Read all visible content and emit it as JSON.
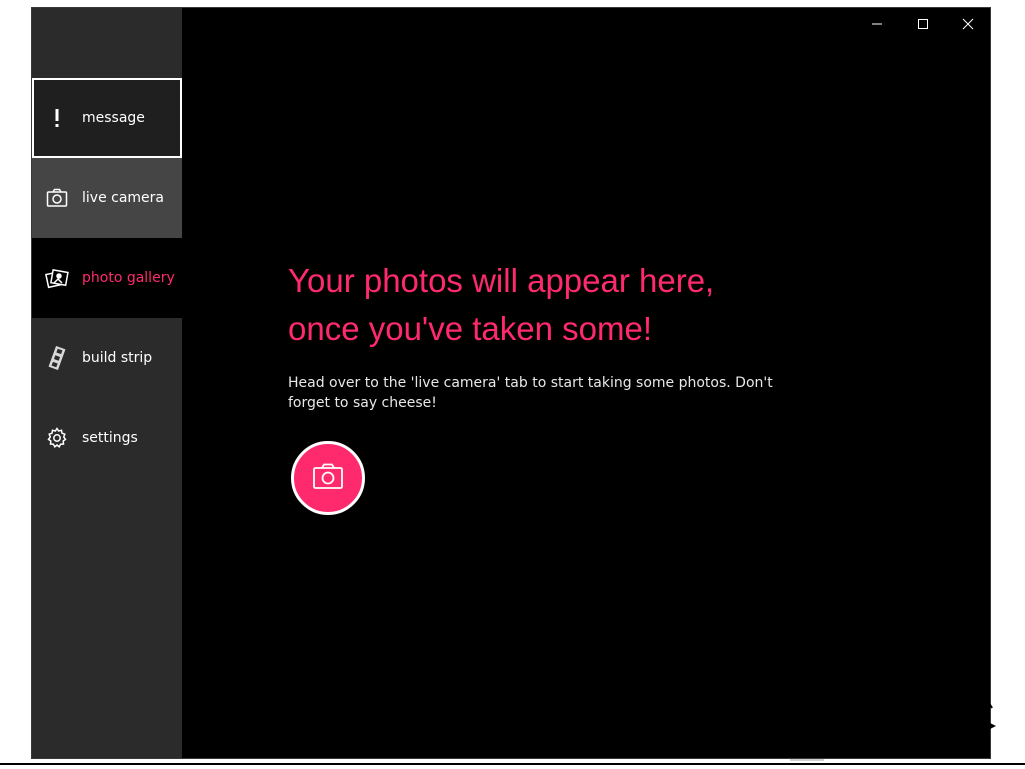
{
  "sidebar": {
    "items": [
      {
        "label": "message",
        "icon": "exclamation-icon"
      },
      {
        "label": "live camera",
        "icon": "camera-icon"
      },
      {
        "label": "photo gallery",
        "icon": "photos-icon"
      },
      {
        "label": "build strip",
        "icon": "film-strip-icon"
      },
      {
        "label": "settings",
        "icon": "gear-icon"
      }
    ]
  },
  "window_controls": {
    "minimize": "minimize-icon",
    "maximize": "maximize-icon",
    "close": "close-icon"
  },
  "main": {
    "headline_line1": "Your photos will appear here,",
    "headline_line2": "once you've taken some!",
    "description": "Head over to the 'live camera' tab to start taking some photos. Don't forget to say cheese!",
    "camera_button_icon": "camera-icon"
  },
  "colors": {
    "accent": "#ff2a6d",
    "sidebar_bg": "#2b2b2b",
    "window_bg": "#000000",
    "hover_bg": "#454545"
  }
}
